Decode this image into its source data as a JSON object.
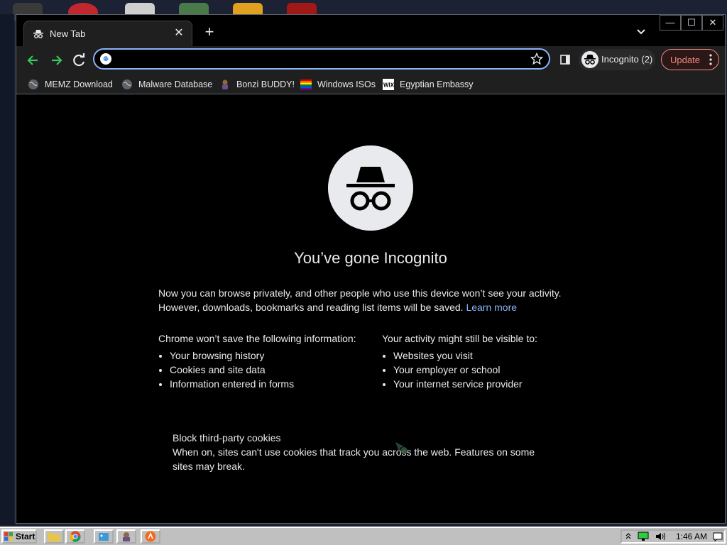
{
  "tab": {
    "title": "New Tab",
    "close": "✕"
  },
  "new_tab": "+",
  "window_controls": {
    "minimize": "—",
    "maximize": "☐",
    "close": "✕"
  },
  "omnibox": {
    "value": "",
    "placeholder": ""
  },
  "profile": {
    "label": "Incognito (2)"
  },
  "update": {
    "label": "Update"
  },
  "bookmarks": [
    {
      "label": "MEMZ Download",
      "icon": "globe-icon"
    },
    {
      "label": "Malware Database",
      "icon": "globe-icon"
    },
    {
      "label": "Bonzi BUDDY!",
      "icon": "bonzi-icon"
    },
    {
      "label": "Windows ISOs",
      "icon": "rainbow-flag-icon"
    },
    {
      "label": "Egyptian Embassy",
      "icon": "wix-icon"
    }
  ],
  "content": {
    "heading": "You’ve gone Incognito",
    "intro_line1": "Now you can browse privately, and other people who use this device won’t see your activity.",
    "intro_line2": "However, downloads, bookmarks and reading list items will be saved.",
    "learn_more": "Learn more",
    "left_heading": "Chrome won’t save the following information:",
    "left_items": [
      "Your browsing history",
      "Cookies and site data",
      "Information entered in forms"
    ],
    "right_heading": "Your activity might still be visible to:",
    "right_items": [
      "Websites you visit",
      "Your employer or school",
      "Your internet service provider"
    ],
    "cookies_title": "Block third-party cookies",
    "cookies_desc": "When on, sites can't use cookies that track you across the web. Features on some sites may break."
  },
  "taskbar": {
    "start": "Start",
    "clock": "1:46 AM"
  },
  "colors": {
    "accent": "#8ab4f8",
    "update": "#f28b82",
    "background": "#000000"
  }
}
